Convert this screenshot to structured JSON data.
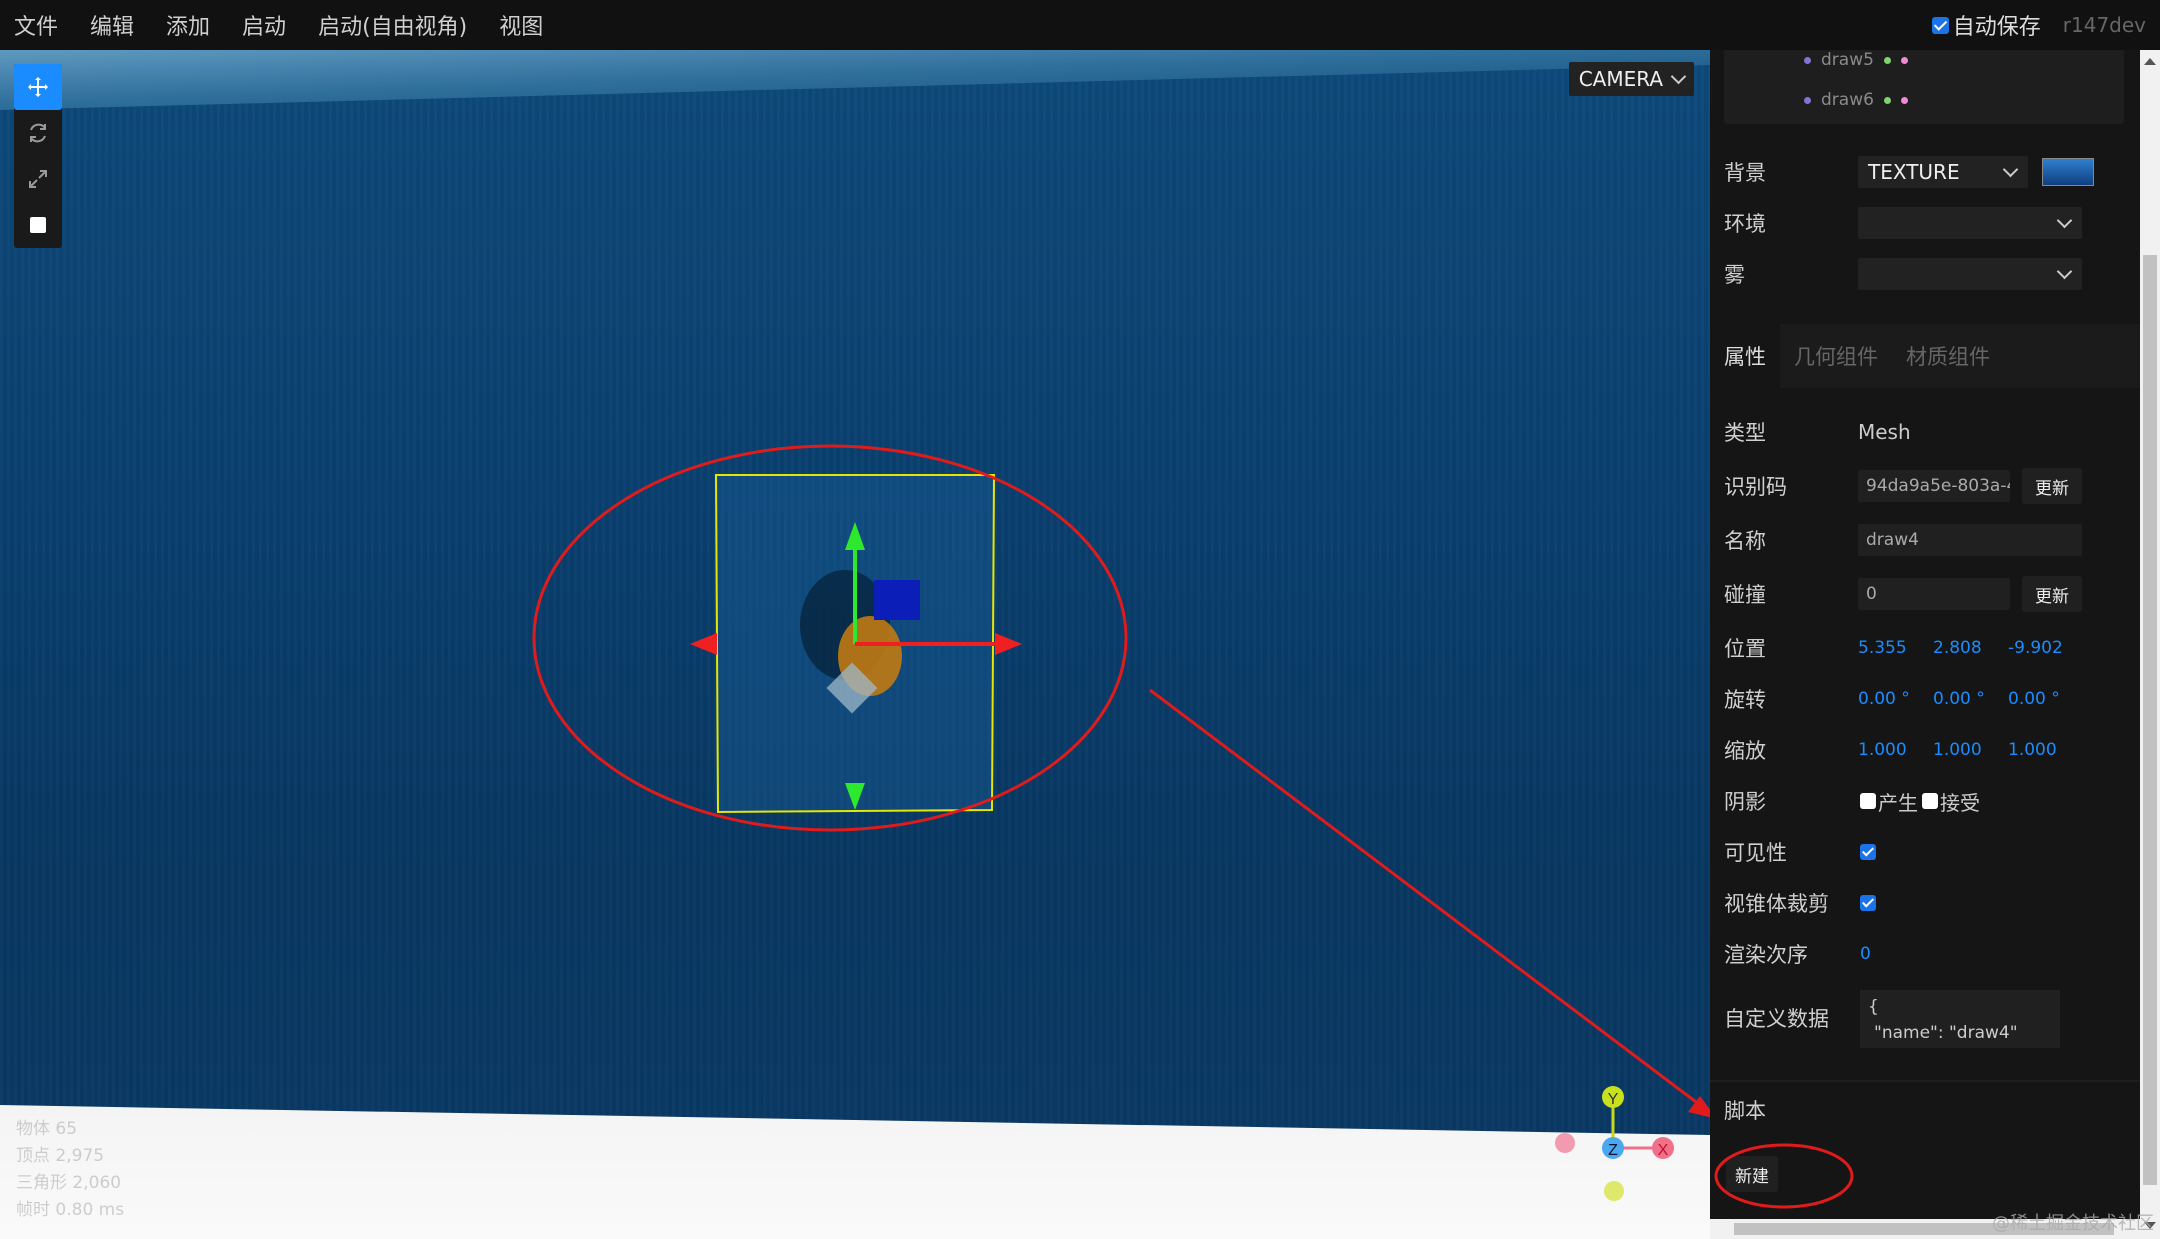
{
  "menubar": {
    "items": [
      "文件",
      "编辑",
      "添加",
      "启动",
      "启动(自由视角)",
      "视图"
    ],
    "autosave_label": "自动保存",
    "autosave_checked": true,
    "version": "r147dev"
  },
  "viewport": {
    "camera_label": "CAMERA",
    "info": [
      "物体 65",
      "顶点 2,975",
      "三角形 2,060",
      "帧时 0.80 ms"
    ],
    "gizmo_axes": [
      "Y",
      "Z",
      "X"
    ],
    "tools": [
      "translate-icon",
      "rotate-icon",
      "scale-icon",
      "local-toggle"
    ]
  },
  "outliner": {
    "items": [
      {
        "label": "draw5"
      },
      {
        "label": "draw6"
      }
    ]
  },
  "scene": {
    "background_label": "背景",
    "background_value": "TEXTURE",
    "environment_label": "环境",
    "environment_value": "",
    "fog_label": "雾",
    "fog_value": ""
  },
  "tabs": [
    "属性",
    "几何组件",
    "材质组件"
  ],
  "properties": {
    "type_label": "类型",
    "type_value": "Mesh",
    "uuid_label": "识别码",
    "uuid_value": "94da9a5e-803a-4",
    "uuid_button": "更新",
    "name_label": "名称",
    "name_value": "draw4",
    "collision_label": "碰撞",
    "collision_value": "0",
    "collision_button": "更新",
    "position_label": "位置",
    "position": [
      "5.355",
      "2.808",
      "-9.902"
    ],
    "rotation_label": "旋转",
    "rotation": [
      "0.00 °",
      "0.00 °",
      "0.00 °"
    ],
    "scale_label": "缩放",
    "scale": [
      "1.000",
      "1.000",
      "1.000"
    ],
    "shadow_label": "阴影",
    "shadow_cast_label": "产生",
    "shadow_receive_label": "接受",
    "visible_label": "可见性",
    "frustum_label": "视锥体裁剪",
    "render_order_label": "渲染次序",
    "render_order_value": "0",
    "userdata_label": "自定义数据",
    "userdata_lines": [
      "{",
      "\"name\": \"draw4\""
    ]
  },
  "script": {
    "label": "脚本",
    "new_button": "新建"
  },
  "watermark": "@稀土掘金技术社区",
  "colors": {
    "accent": "#1a8cff",
    "annotation": "#e01b1b"
  }
}
